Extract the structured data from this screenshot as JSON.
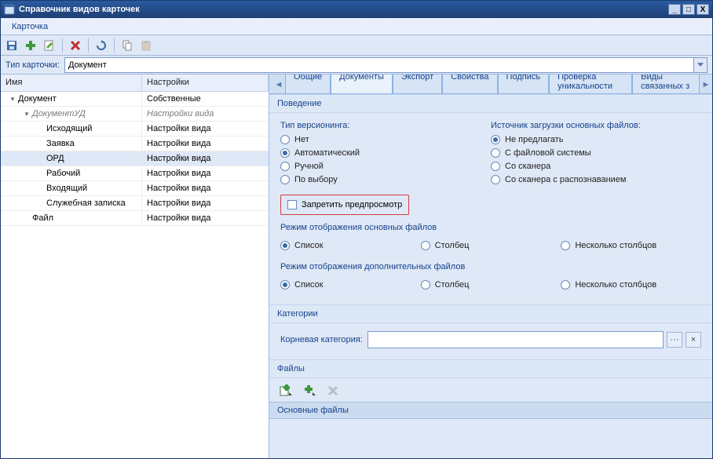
{
  "window": {
    "title": "Справочник видов карточек"
  },
  "menu": {
    "karta": "Карточка"
  },
  "toolbar_icons": {
    "save": "save-icon",
    "add": "add-icon",
    "edit": "edit-icon",
    "delete": "delete-icon",
    "refresh": "refresh-icon",
    "copy": "copy-icon",
    "paste": "paste-icon"
  },
  "typebar": {
    "label": "Тип карточки:",
    "value": "Документ"
  },
  "grid": {
    "headers": {
      "name": "Имя",
      "settings": "Настройки"
    },
    "rows": [
      {
        "indent": 0,
        "tog": "▾",
        "name": "Документ",
        "settings": "Собственные",
        "italic": false,
        "sel": false
      },
      {
        "indent": 1,
        "tog": "▾",
        "name": "ДокументУД",
        "settings": "Настройки вида",
        "italic": true,
        "sel": false
      },
      {
        "indent": 2,
        "tog": "",
        "name": "Исходящий",
        "settings": "Настройки вида",
        "italic": false,
        "sel": false
      },
      {
        "indent": 2,
        "tog": "",
        "name": "Заявка",
        "settings": "Настройки вида",
        "italic": false,
        "sel": false
      },
      {
        "indent": 2,
        "tog": "",
        "name": "ОРД",
        "settings": "Настройки вида",
        "italic": false,
        "sel": true
      },
      {
        "indent": 2,
        "tog": "",
        "name": "Рабочий",
        "settings": "Настройки вида",
        "italic": false,
        "sel": false
      },
      {
        "indent": 2,
        "tog": "",
        "name": "Входящий",
        "settings": "Настройки вида",
        "italic": false,
        "sel": false
      },
      {
        "indent": 2,
        "tog": "",
        "name": "Служебная записка",
        "settings": "Настройки вида",
        "italic": false,
        "sel": false
      },
      {
        "indent": 1,
        "tog": "",
        "name": "Файл",
        "settings": "Настройки вида",
        "italic": false,
        "sel": false
      }
    ]
  },
  "tabs": {
    "items": [
      "Общие",
      "Документы",
      "Экспорт",
      "Свойства",
      "Подпись",
      "Проверка уникальности",
      "Виды связанных з"
    ],
    "active": 1
  },
  "sections": {
    "behavior": {
      "title": "Поведение",
      "versioning_label": "Тип версионинга:",
      "versioning": [
        {
          "label": "Нет",
          "on": false
        },
        {
          "label": "Автоматический",
          "on": true
        },
        {
          "label": "Ручной",
          "on": false
        },
        {
          "label": "По выбору",
          "on": false
        }
      ],
      "source_label": "Источник загрузки основных файлов:",
      "source": [
        {
          "label": "Не предлагать",
          "on": true
        },
        {
          "label": "С файловой системы",
          "on": false
        },
        {
          "label": "Со сканера",
          "on": false
        },
        {
          "label": "Со сканера с распознаванием",
          "on": false
        }
      ],
      "forbid_preview": "Запретить предпросмотр",
      "main_mode_label": "Режим отображения основных файлов",
      "main_mode": [
        {
          "label": "Список",
          "on": true
        },
        {
          "label": "Столбец",
          "on": false
        },
        {
          "label": "Несколько столбцов",
          "on": false
        }
      ],
      "extra_mode_label": "Режим отображения дополнительных файлов",
      "extra_mode": [
        {
          "label": "Список",
          "on": true
        },
        {
          "label": "Столбец",
          "on": false
        },
        {
          "label": "Несколько столбцов",
          "on": false
        }
      ]
    },
    "categories": {
      "title": "Категории",
      "root_label": "Корневая категория:",
      "root_value": "",
      "browse": "···",
      "clear": "×"
    },
    "files": {
      "title": "Файлы",
      "main_header": "Основные файлы"
    }
  }
}
